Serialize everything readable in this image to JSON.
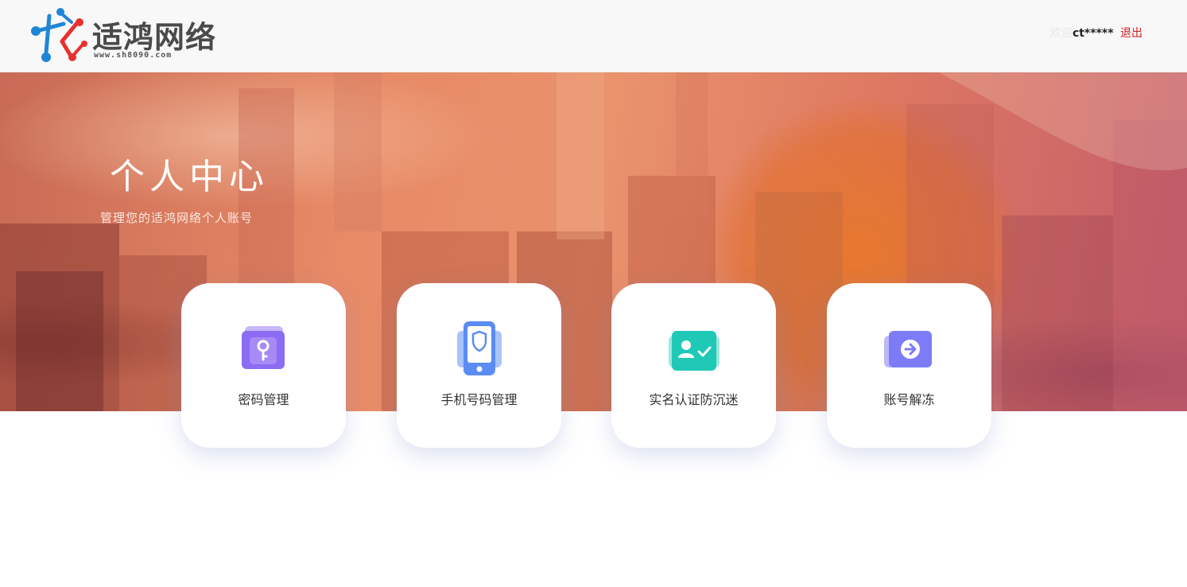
{
  "header": {
    "logo_title": "适鸿网络",
    "logo_url": "www.sh8090.com",
    "greeting": "欢迎",
    "username": "ct*****",
    "logout_label": "退出"
  },
  "banner": {
    "title": "个人中心",
    "subtitle": "管理您的适鸿网络个人账号"
  },
  "cards": [
    {
      "label": "密码管理",
      "icon": "key-lock-icon",
      "color": "#8c6cf2"
    },
    {
      "label": "手机号码管理",
      "icon": "phone-shield-icon",
      "color": "#5b8cf5"
    },
    {
      "label": "实名认证防沉迷",
      "icon": "id-verify-icon",
      "color": "#1fc9b6"
    },
    {
      "label": "账号解冻",
      "icon": "arrow-unlock-icon",
      "color": "#7d7cf6"
    }
  ],
  "colors": {
    "logout": "#d9181d",
    "logo_blue": "#1f86d6",
    "logo_red": "#e8302f"
  }
}
